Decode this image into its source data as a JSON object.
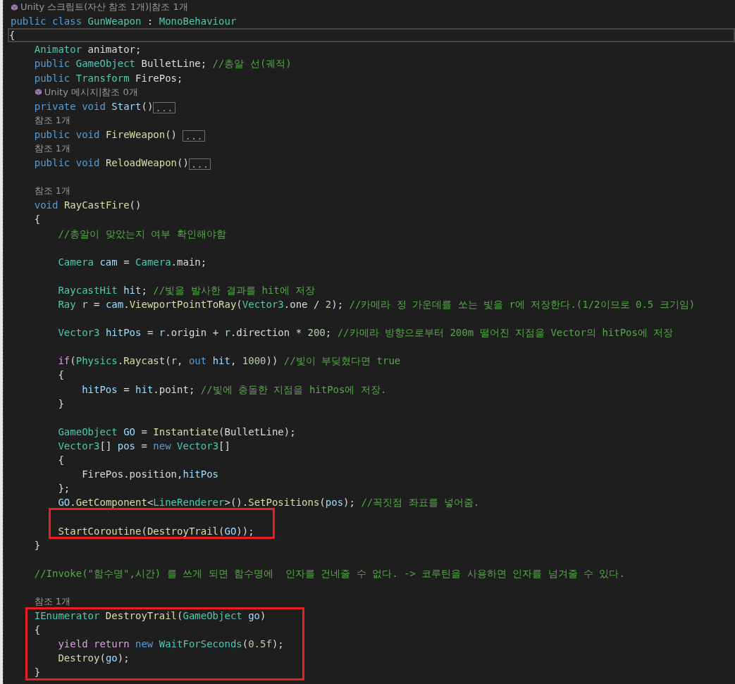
{
  "editor": {
    "blocks": [
      {
        "boxed": false,
        "lines": [
          {
            "kind": "lens",
            "icon": true,
            "text": "Unity 스크립트(자산 참조 1개)|참조 1개"
          },
          {
            "kind": "code",
            "current": false,
            "tokens": [
              {
                "kind": "kw",
                "text": "public class "
              },
              {
                "kind": "type",
                "text": "GunWeapon"
              },
              {
                "kind": "plain",
                "text": " : "
              },
              {
                "kind": "type",
                "text": "MonoBehaviour"
              }
            ]
          },
          {
            "kind": "code",
            "current": true,
            "tokens": [
              {
                "kind": "plain",
                "text": "{"
              }
            ]
          },
          {
            "kind": "code",
            "current": false,
            "tokens": [
              {
                "kind": "type",
                "text": "    Animator"
              },
              {
                "kind": "plain",
                "text": " animator;"
              }
            ]
          },
          {
            "kind": "code",
            "current": false,
            "tokens": [
              {
                "kind": "kw",
                "text": "    public "
              },
              {
                "kind": "type",
                "text": "GameObject"
              },
              {
                "kind": "plain",
                "text": " BulletLine; "
              },
              {
                "kind": "comment",
                "text": "//총알 선(궤적)"
              }
            ]
          },
          {
            "kind": "code",
            "current": false,
            "tokens": [
              {
                "kind": "kw",
                "text": "    public "
              },
              {
                "kind": "type",
                "text": "Transform"
              },
              {
                "kind": "plain",
                "text": " FirePos;"
              }
            ]
          },
          {
            "kind": "lens",
            "icon": true,
            "text": "    Unity 메시지|참조 0개"
          },
          {
            "kind": "code",
            "current": false,
            "fold": "...",
            "tokens": [
              {
                "kind": "kw",
                "text": "    private void "
              },
              {
                "kind": "var",
                "text": "Start"
              },
              {
                "kind": "plain",
                "text": "()"
              }
            ]
          },
          {
            "kind": "lens",
            "icon": false,
            "text": "    참조 1개"
          },
          {
            "kind": "code",
            "current": false,
            "fold": "...",
            "tokens": [
              {
                "kind": "kw",
                "text": "    public void "
              },
              {
                "kind": "method",
                "text": "FireWeapon"
              },
              {
                "kind": "plain",
                "text": "() "
              }
            ]
          },
          {
            "kind": "lens",
            "icon": false,
            "text": "    참조 1개"
          },
          {
            "kind": "code",
            "current": false,
            "fold": "...",
            "tokens": [
              {
                "kind": "kw",
                "text": "    public void "
              },
              {
                "kind": "method",
                "text": "ReloadWeapon"
              },
              {
                "kind": "plain",
                "text": "()"
              }
            ]
          },
          {
            "kind": "blank"
          },
          {
            "kind": "lens",
            "icon": false,
            "text": "    참조 1개"
          },
          {
            "kind": "code",
            "current": false,
            "tokens": [
              {
                "kind": "kw",
                "text": "    void "
              },
              {
                "kind": "method",
                "text": "RayCastFire"
              },
              {
                "kind": "plain",
                "text": "()"
              }
            ]
          },
          {
            "kind": "code",
            "current": false,
            "tokens": [
              {
                "kind": "plain",
                "text": "    {"
              }
            ]
          },
          {
            "kind": "code",
            "current": false,
            "tokens": [
              {
                "kind": "comment",
                "text": "        //총알이 맞았는지 여부 확인해야함"
              }
            ]
          },
          {
            "kind": "blank"
          },
          {
            "kind": "code",
            "current": false,
            "tokens": [
              {
                "kind": "type",
                "text": "        Camera"
              },
              {
                "kind": "var",
                "text": " cam"
              },
              {
                "kind": "plain",
                "text": " = "
              },
              {
                "kind": "type",
                "text": "Camera"
              },
              {
                "kind": "plain",
                "text": ".main;"
              }
            ]
          },
          {
            "kind": "blank"
          },
          {
            "kind": "code",
            "current": false,
            "tokens": [
              {
                "kind": "type",
                "text": "        RaycastHit"
              },
              {
                "kind": "var",
                "text": " hit"
              },
              {
                "kind": "plain",
                "text": "; "
              },
              {
                "kind": "comment",
                "text": "//빛을 발사한 결과를 hit에 저장"
              }
            ]
          },
          {
            "kind": "code",
            "current": false,
            "tokens": [
              {
                "kind": "type",
                "text": "        Ray"
              },
              {
                "kind": "var",
                "text": " r"
              },
              {
                "kind": "plain",
                "text": " = "
              },
              {
                "kind": "var",
                "text": "cam"
              },
              {
                "kind": "plain",
                "text": "."
              },
              {
                "kind": "method",
                "text": "ViewportPointToRay"
              },
              {
                "kind": "plain",
                "text": "("
              },
              {
                "kind": "type",
                "text": "Vector3"
              },
              {
                "kind": "plain",
                "text": ".one / "
              },
              {
                "kind": "num",
                "text": "2"
              },
              {
                "kind": "plain",
                "text": "); "
              },
              {
                "kind": "comment",
                "text": "//카메라 정 가운데를 쏘는 빛을 r에 저장한다.(1/2이므로 0.5 크기임)"
              }
            ]
          },
          {
            "kind": "blank"
          },
          {
            "kind": "code",
            "current": false,
            "tokens": [
              {
                "kind": "type",
                "text": "        Vector3"
              },
              {
                "kind": "var",
                "text": " hitPos"
              },
              {
                "kind": "plain",
                "text": " = "
              },
              {
                "kind": "var",
                "text": "r"
              },
              {
                "kind": "plain",
                "text": ".origin + "
              },
              {
                "kind": "var",
                "text": "r"
              },
              {
                "kind": "plain",
                "text": ".direction * "
              },
              {
                "kind": "num",
                "text": "200"
              },
              {
                "kind": "plain",
                "text": "; "
              },
              {
                "kind": "comment",
                "text": "//카메라 방향으로부터 200m 떨어진 지점을 Vector의 hitPos에 저장"
              }
            ]
          },
          {
            "kind": "blank"
          },
          {
            "kind": "code",
            "current": false,
            "tokens": [
              {
                "kind": "ctrl",
                "text": "        if"
              },
              {
                "kind": "plain",
                "text": "("
              },
              {
                "kind": "type",
                "text": "Physics"
              },
              {
                "kind": "plain",
                "text": "."
              },
              {
                "kind": "method",
                "text": "Raycast"
              },
              {
                "kind": "plain",
                "text": "("
              },
              {
                "kind": "var",
                "text": "r"
              },
              {
                "kind": "plain",
                "text": ", "
              },
              {
                "kind": "kw",
                "text": "out"
              },
              {
                "kind": "var",
                "text": " hit"
              },
              {
                "kind": "plain",
                "text": ", "
              },
              {
                "kind": "num",
                "text": "1000"
              },
              {
                "kind": "plain",
                "text": ")) "
              },
              {
                "kind": "comment",
                "text": "//빛이 부딪혔다면 true"
              }
            ]
          },
          {
            "kind": "code",
            "current": false,
            "tokens": [
              {
                "kind": "plain",
                "text": "        {"
              }
            ]
          },
          {
            "kind": "code",
            "current": false,
            "tokens": [
              {
                "kind": "var",
                "text": "            hitPos"
              },
              {
                "kind": "plain",
                "text": " = "
              },
              {
                "kind": "var",
                "text": "hit"
              },
              {
                "kind": "plain",
                "text": ".point; "
              },
              {
                "kind": "comment",
                "text": "//빛에 충돌한 지점을 hitPos에 저장."
              }
            ]
          },
          {
            "kind": "code",
            "current": false,
            "tokens": [
              {
                "kind": "plain",
                "text": "        }"
              }
            ]
          },
          {
            "kind": "blank"
          },
          {
            "kind": "code",
            "current": false,
            "tokens": [
              {
                "kind": "type",
                "text": "        GameObject"
              },
              {
                "kind": "var",
                "text": " GO"
              },
              {
                "kind": "plain",
                "text": " = "
              },
              {
                "kind": "method",
                "text": "Instantiate"
              },
              {
                "kind": "plain",
                "text": "(BulletLine);"
              }
            ]
          },
          {
            "kind": "code",
            "current": false,
            "tokens": [
              {
                "kind": "type",
                "text": "        Vector3"
              },
              {
                "kind": "plain",
                "text": "[] "
              },
              {
                "kind": "var",
                "text": "pos"
              },
              {
                "kind": "plain",
                "text": " = "
              },
              {
                "kind": "kw",
                "text": "new "
              },
              {
                "kind": "type",
                "text": "Vector3"
              },
              {
                "kind": "plain",
                "text": "[]"
              }
            ]
          },
          {
            "kind": "code",
            "current": false,
            "tokens": [
              {
                "kind": "plain",
                "text": "        {"
              }
            ]
          },
          {
            "kind": "code",
            "current": false,
            "tokens": [
              {
                "kind": "plain",
                "text": "            FirePos.position,"
              },
              {
                "kind": "var",
                "text": "hitPos"
              }
            ]
          },
          {
            "kind": "code",
            "current": false,
            "tokens": [
              {
                "kind": "plain",
                "text": "        };"
              }
            ]
          },
          {
            "kind": "code",
            "current": false,
            "tokens": [
              {
                "kind": "var",
                "text": "        GO"
              },
              {
                "kind": "plain",
                "text": "."
              },
              {
                "kind": "method",
                "text": "GetComponent"
              },
              {
                "kind": "plain",
                "text": "<"
              },
              {
                "kind": "type",
                "text": "LineRenderer"
              },
              {
                "kind": "plain",
                "text": ">()."
              },
              {
                "kind": "method",
                "text": "SetPositions"
              },
              {
                "kind": "plain",
                "text": "("
              },
              {
                "kind": "var",
                "text": "pos"
              },
              {
                "kind": "plain",
                "text": "); "
              },
              {
                "kind": "comment",
                "text": "//꼭짓점 좌표를 넣어줌."
              }
            ]
          }
        ]
      },
      {
        "boxed": true,
        "lines": [
          {
            "kind": "blank"
          },
          {
            "kind": "code",
            "current": false,
            "tokens": [
              {
                "kind": "method",
                "text": "        StartCoroutine"
              },
              {
                "kind": "plain",
                "text": "("
              },
              {
                "kind": "method",
                "text": "DestroyTrail"
              },
              {
                "kind": "plain",
                "text": "("
              },
              {
                "kind": "var",
                "text": "GO"
              },
              {
                "kind": "plain",
                "text": "));"
              }
            ]
          }
        ]
      },
      {
        "boxed": false,
        "lines": [
          {
            "kind": "code",
            "current": false,
            "tokens": [
              {
                "kind": "plain",
                "text": "    }"
              }
            ]
          },
          {
            "kind": "blank"
          },
          {
            "kind": "code",
            "current": false,
            "tokens": [
              {
                "kind": "comment",
                "text": "    //Invoke(\"함수명\",시간) 를 쓰게 되면 함수명에  인자를 건네줄 수 없다. -> 코루틴을 사용하면 인자를 넘겨줄 수 있다."
              }
            ]
          },
          {
            "kind": "blank"
          },
          {
            "kind": "lens",
            "icon": false,
            "text": "    참조 1개"
          }
        ]
      },
      {
        "boxed": true,
        "lines": [
          {
            "kind": "code",
            "current": false,
            "tokens": [
              {
                "kind": "type",
                "text": "    IEnumerator"
              },
              {
                "kind": "method",
                "text": " DestroyTrail"
              },
              {
                "kind": "plain",
                "text": "("
              },
              {
                "kind": "type",
                "text": "GameObject"
              },
              {
                "kind": "var",
                "text": " go"
              },
              {
                "kind": "plain",
                "text": ")"
              }
            ]
          },
          {
            "kind": "code",
            "current": false,
            "tokens": [
              {
                "kind": "plain",
                "text": "    {"
              }
            ]
          },
          {
            "kind": "code",
            "current": false,
            "tokens": [
              {
                "kind": "ctrl",
                "text": "        yield return "
              },
              {
                "kind": "kw",
                "text": "new "
              },
              {
                "kind": "type",
                "text": "WaitForSeconds"
              },
              {
                "kind": "plain",
                "text": "("
              },
              {
                "kind": "num",
                "text": "0.5f"
              },
              {
                "kind": "plain",
                "text": ");"
              }
            ]
          },
          {
            "kind": "code",
            "current": false,
            "tokens": [
              {
                "kind": "method",
                "text": "        Destroy"
              },
              {
                "kind": "plain",
                "text": "("
              },
              {
                "kind": "var",
                "text": "go"
              },
              {
                "kind": "plain",
                "text": ");"
              }
            ]
          },
          {
            "kind": "code",
            "current": false,
            "tokens": [
              {
                "kind": "plain",
                "text": "    }"
              }
            ]
          }
        ]
      }
    ]
  }
}
